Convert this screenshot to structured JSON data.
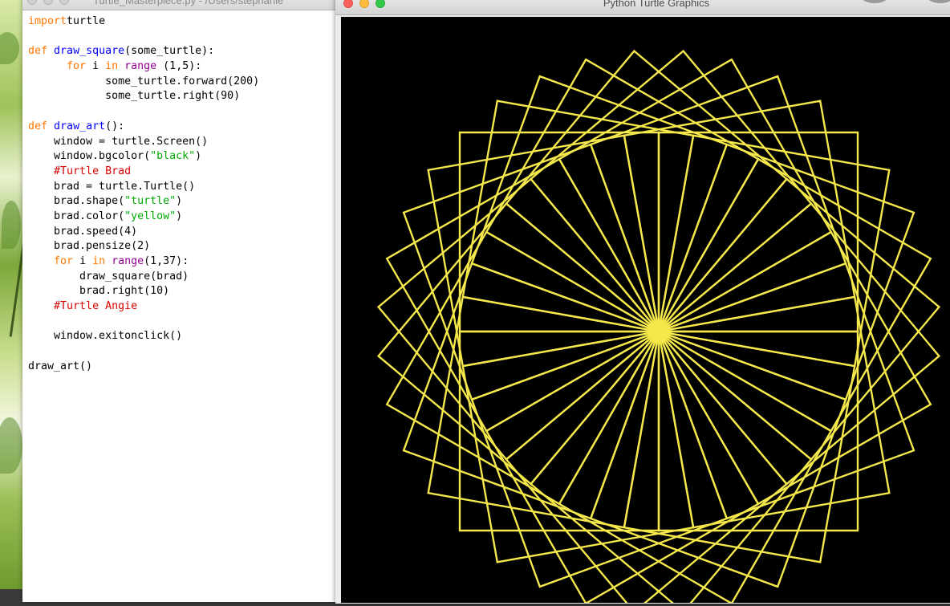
{
  "editor": {
    "title": "Turtle_Masterpiece.py - /Users/stephanie",
    "code_lines": [
      [
        [
          "kw",
          "import"
        ],
        [
          "",
          "turtle"
        ]
      ],
      [],
      [
        [
          "kw",
          "def"
        ],
        [
          "",
          " "
        ],
        [
          "fn",
          "draw_square"
        ],
        [
          "",
          "(some_turtle):"
        ]
      ],
      [
        [
          "",
          "      "
        ],
        [
          "kw",
          "for"
        ],
        [
          "",
          " i "
        ],
        [
          "kw",
          "in"
        ],
        [
          "",
          " "
        ],
        [
          "bi",
          "range"
        ],
        [
          "",
          " (1,5):"
        ]
      ],
      [
        [
          "",
          "            some_turtle.forward(200)"
        ]
      ],
      [
        [
          "",
          "            some_turtle.right(90)"
        ]
      ],
      [],
      [
        [
          "kw",
          "def"
        ],
        [
          "",
          " "
        ],
        [
          "fn",
          "draw_art"
        ],
        [
          "",
          "():"
        ]
      ],
      [
        [
          "",
          "    window = turtle.Screen()"
        ]
      ],
      [
        [
          "",
          "    window.bgcolor("
        ],
        [
          "str",
          "\"black\""
        ],
        [
          "",
          ")"
        ]
      ],
      [
        [
          "",
          "    "
        ],
        [
          "cm",
          "#Turtle Brad"
        ]
      ],
      [
        [
          "",
          "    brad = turtle.Turtle()"
        ]
      ],
      [
        [
          "",
          "    brad.shape("
        ],
        [
          "str",
          "\"turtle\""
        ],
        [
          "",
          ")"
        ]
      ],
      [
        [
          "",
          "    brad.color("
        ],
        [
          "str",
          "\"yellow\""
        ],
        [
          "",
          ")"
        ]
      ],
      [
        [
          "",
          "    brad.speed(4)"
        ]
      ],
      [
        [
          "",
          "    brad.pensize(2)"
        ]
      ],
      [
        [
          "",
          "    "
        ],
        [
          "kw",
          "for"
        ],
        [
          "",
          " i "
        ],
        [
          "kw",
          "in"
        ],
        [
          "",
          " "
        ],
        [
          "bi",
          "range"
        ],
        [
          "",
          "(1,37):"
        ]
      ],
      [
        [
          "",
          "        draw_square(brad)"
        ]
      ],
      [
        [
          "",
          "        brad.right(10)"
        ]
      ],
      [
        [
          "",
          "    "
        ],
        [
          "cm",
          "#Turtle Angie"
        ]
      ],
      [],
      [
        [
          "",
          "    window.exitonclick()"
        ]
      ],
      [],
      [
        [
          "",
          "draw_art()"
        ]
      ]
    ]
  },
  "turtle_window": {
    "title": "Python Turtle Graphics",
    "canvas": {
      "background": "#000000",
      "pen_color": "#f5e84a",
      "square_count": 36,
      "turn_degrees": 10,
      "side_length": 200
    }
  },
  "colors": {
    "keyword": "#ff7700",
    "builtin": "#900090",
    "function_name": "#0000ff",
    "string": "#00aa00",
    "comment": "#dd0000"
  }
}
